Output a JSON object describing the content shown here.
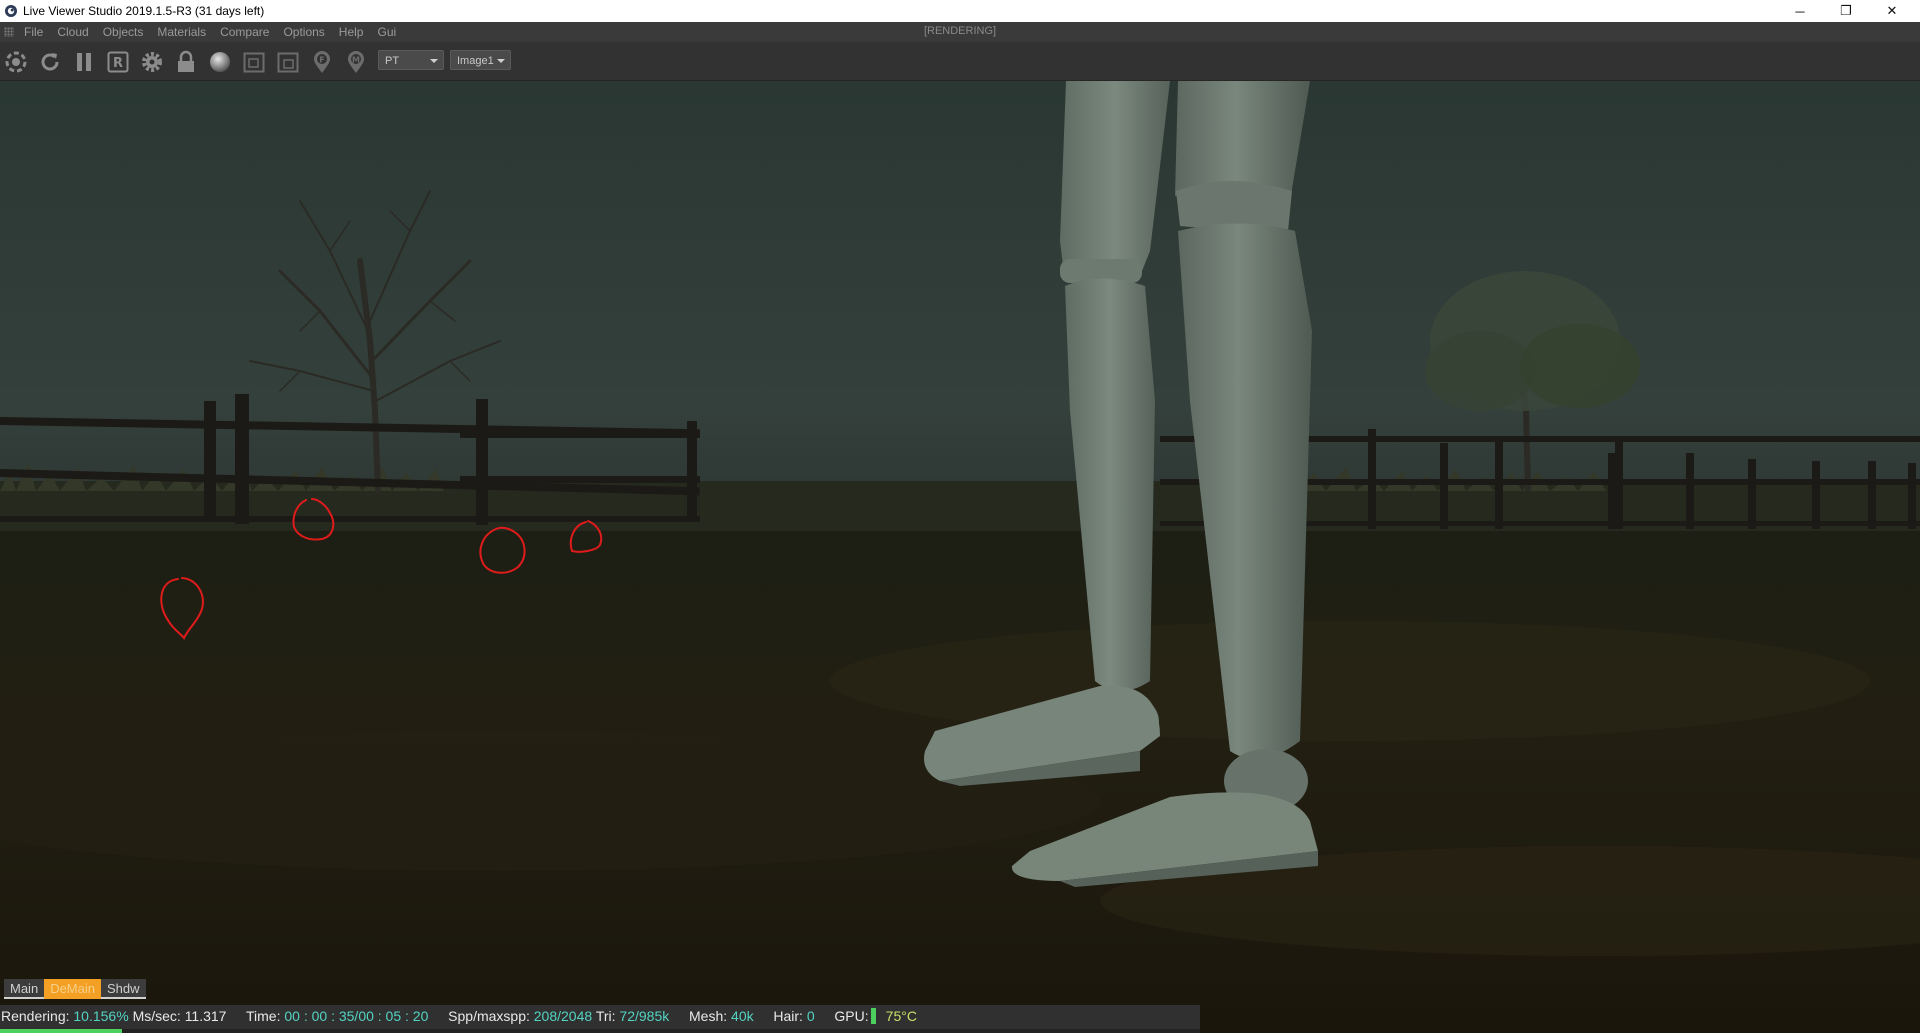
{
  "window": {
    "title": "Live Viewer Studio 2019.1.5-R3 (31 days left)",
    "minimize": "─",
    "restore": "❐",
    "close": "✕"
  },
  "menu": {
    "items": [
      "File",
      "Cloud",
      "Objects",
      "Materials",
      "Compare",
      "Options",
      "Help",
      "Gui"
    ],
    "render_state": "[RENDERING]"
  },
  "toolbar": {
    "icons": [
      "aperture-icon",
      "refresh-icon",
      "pause-icon",
      "r-icon",
      "gear-icon",
      "lock-icon",
      "sphere-icon",
      "region-icon",
      "region-alt-icon",
      "pin-f-icon",
      "pin-m-icon"
    ],
    "r_letter": "R",
    "pin_f_letter": "F",
    "pin_m_letter": "M",
    "kernel_select": "PT",
    "image_select": "Image1"
  },
  "passes": {
    "tabs": [
      "Main",
      "DeMain",
      "Shdw"
    ],
    "active_index": 1
  },
  "status": {
    "rendering_label": "Rendering:",
    "rendering_value": "10.156%",
    "mssec_label": "Ms/sec:",
    "mssec_value": "11.317",
    "time_label": "Time:",
    "time_value": "00 : 00 : 35/00 : 05 : 20",
    "spp_label": "Spp/maxspp:",
    "spp_value": "208/2048",
    "tri_label": "Tri:",
    "tri_value": "72/985k",
    "mesh_label": "Mesh:",
    "mesh_value": "40k",
    "hair_label": "Hair:",
    "hair_value": "0",
    "gpu_label": "GPU:",
    "gpu_temp": "75°C",
    "progress_fraction": 0.10156
  },
  "colors": {
    "accent_tab": "#f3a024",
    "status_value": "#53d3c2",
    "progress": "#4cd05e",
    "annotation": "#e01b1b"
  }
}
